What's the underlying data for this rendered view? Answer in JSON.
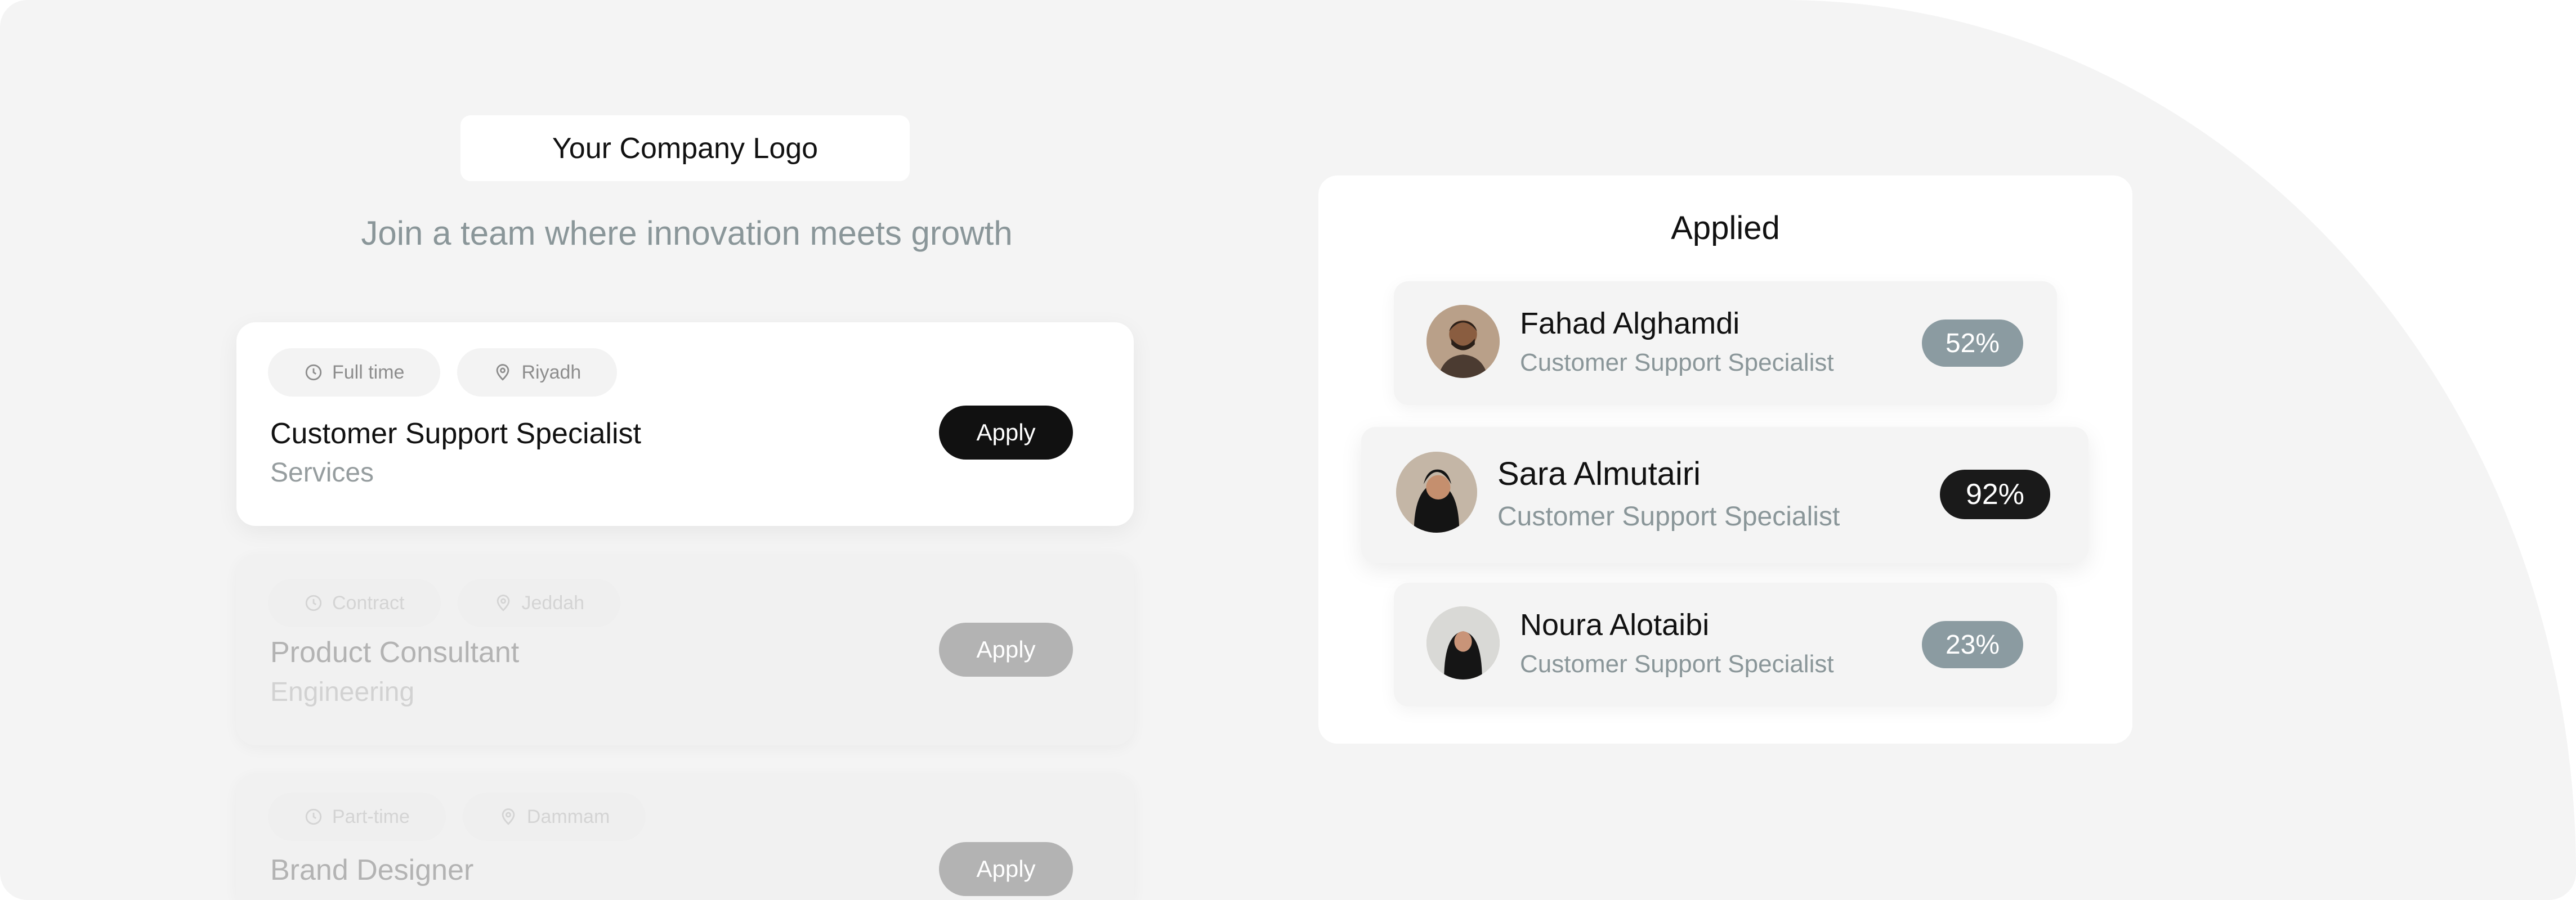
{
  "logo_text": "Your Company Logo",
  "tagline": "Join a team where innovation meets growth",
  "jobs": [
    {
      "type": "Full time",
      "location": "Riyadh",
      "title": "Customer Support Specialist",
      "department": "Services",
      "apply_label": "Apply"
    },
    {
      "type": "Contract",
      "location": "Jeddah",
      "title": "Product Consultant",
      "department": "Engineering",
      "apply_label": "Apply"
    },
    {
      "type": "Part-time",
      "location": "Dammam",
      "title": "Brand Designer",
      "apply_label": "Apply"
    }
  ],
  "applied": {
    "title": "Applied",
    "candidates": [
      {
        "name": "Fahad Alghamdi",
        "role": "Customer Support Specialist",
        "match": "52%"
      },
      {
        "name": "Sara Almutairi",
        "role": "Customer Support Specialist",
        "match": "92%"
      },
      {
        "name": "Noura Alotaibi",
        "role": "Customer Support Specialist",
        "match": "23%"
      }
    ]
  },
  "colors": {
    "accent_dark": "#111111",
    "badge_gray": "#8b9ba1",
    "muted_text": "#8a9699"
  },
  "icons": {
    "job_type": "clock-icon",
    "location": "map-pin-icon"
  }
}
